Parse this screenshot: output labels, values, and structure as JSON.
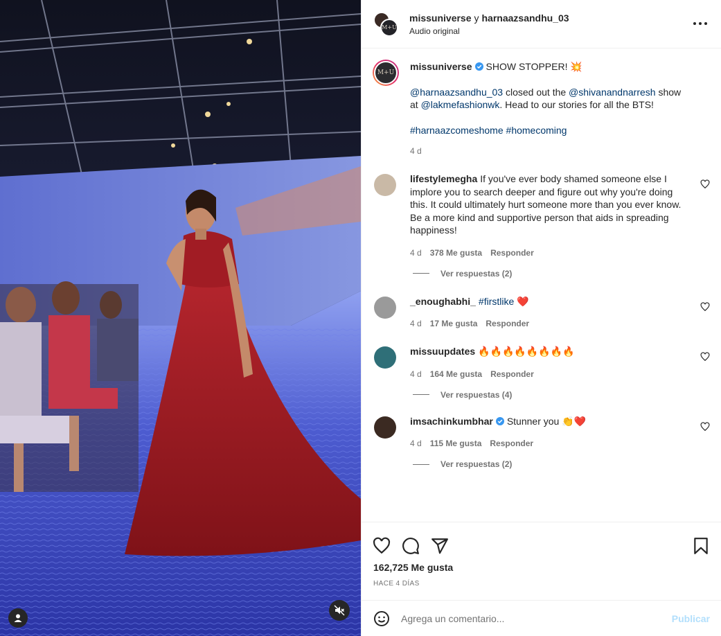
{
  "post": {
    "owner": "missuniverse",
    "joiner": "y",
    "collaborator": "harnaazsandhu_03",
    "audio": "Audio original",
    "avatar_initials": "M+U"
  },
  "caption": {
    "username": "missuniverse",
    "headline": "SHOW STOPPER! 💥",
    "mention_1": "@harnaazsandhu_03",
    "text_1": " closed out the ",
    "mention_2": "@shivanandnarresh",
    "text_2": " show at ",
    "mention_3": "@lakmefashionwk",
    "text_3": ". Head to our stories for all the BTS!",
    "hashtag_1": "#harnaazcomeshome",
    "hashtag_2": "#homecoming",
    "time": "4 d"
  },
  "comments": [
    {
      "username": "lifestylemegha",
      "text": "If you've ever body shamed someone else I implore you to search deeper and figure out why you're doing this. It could ultimately hurt someone more than you ever know. Be a more kind and supportive person that aids in spreading happiness!",
      "time": "4 d",
      "likes": "378 Me gusta",
      "reply": "Responder",
      "view_replies": "Ver respuestas (2)",
      "avatar_color": "#c9b9a6"
    },
    {
      "username": "_enoughabhi_",
      "hashtag": "#firstlike",
      "emoji": "❤️",
      "time": "4 d",
      "likes": "17 Me gusta",
      "reply": "Responder",
      "avatar_color": "#9a9a9a"
    },
    {
      "username": "missuupdates",
      "text": "🔥🔥🔥🔥🔥🔥🔥🔥",
      "time": "4 d",
      "likes": "164 Me gusta",
      "reply": "Responder",
      "view_replies": "Ver respuestas (4)",
      "avatar_color": "#2f6f78"
    },
    {
      "username": "imsachinkumbhar",
      "text": "Stunner you 👏❤️",
      "time": "4 d",
      "likes": "115 Me gusta",
      "reply": "Responder",
      "view_replies": "Ver respuestas (2)",
      "avatar_color": "#3b2a22"
    }
  ],
  "stats": {
    "likes": "162,725 Me gusta",
    "ago": "HACE 4 DÍAS"
  },
  "composer": {
    "placeholder": "Agrega un comentario...",
    "post_label": "Publicar"
  },
  "colors": {
    "link": "#00376b",
    "muted": "#737373",
    "verified": "#3897f0",
    "post_disabled": "#b2dffc",
    "dress": "#9e1b22"
  },
  "icons": [
    "user-tag-icon",
    "mute-icon",
    "more-icon",
    "heart-icon",
    "comment-icon",
    "share-icon",
    "save-icon",
    "emoji-icon",
    "verified-icon"
  ]
}
